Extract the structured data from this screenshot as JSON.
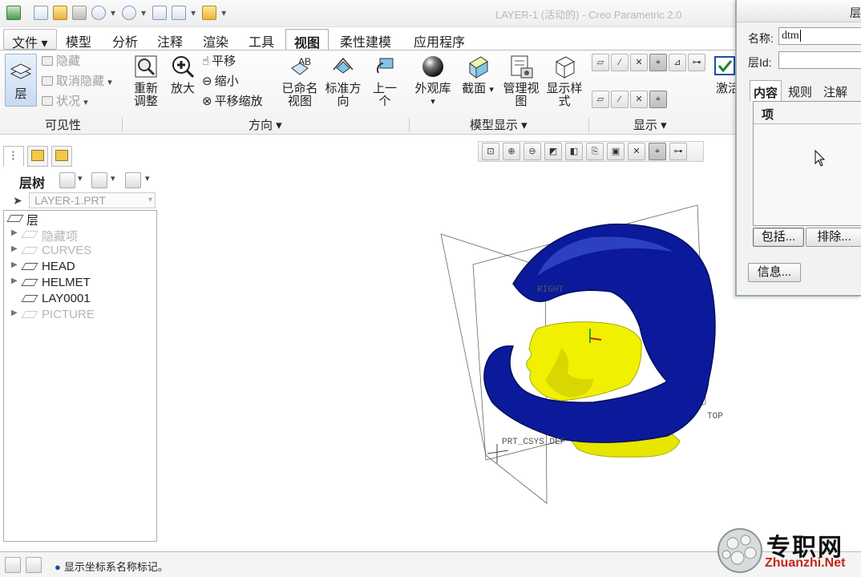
{
  "titlebar": {
    "title": "LAYER-1 (活动的) - Creo Parametric 2.0",
    "icons": [
      "creo-app-icon",
      "new-icon",
      "open-icon",
      "save-icon",
      "undo-icon",
      "redo-icon",
      "regenerate-icon",
      "windows-icon",
      "close-window-icon",
      "customize-icon"
    ]
  },
  "menu": {
    "tabs": [
      "文件",
      "模型",
      "分析",
      "注释",
      "渲染",
      "工具",
      "视图",
      "柔性建模",
      "应用程序"
    ],
    "active": "视图"
  },
  "ribbon": {
    "visibility": {
      "layer_label": "层",
      "hide_label": "隐藏",
      "unhide_label": "取消隐藏",
      "status_label": "状况",
      "group_label": "可见性"
    },
    "orientation": {
      "refit_label": "重新调整",
      "zoom_in_label": "放大",
      "pan_label": "平移",
      "zoom_out_label": "缩小",
      "pan_zoom_label": "平移缩放",
      "group_label": "方向"
    },
    "model_display": {
      "saved_views_label": "已命名视图",
      "standard_orient_label": "标准方向",
      "previous_label": "上一个",
      "appearance_label": "外观库",
      "section_label": "截面",
      "manage_views_label": "管理视图",
      "display_style_label": "显示样式",
      "group_label": "模型显示"
    },
    "show": {
      "group_label": "显示",
      "activate_label": "激活"
    }
  },
  "left_panel": {
    "tree_title": "层树",
    "model_name": "LAYER-1.PRT",
    "root_label": "层",
    "items": [
      {
        "label": "隐藏项",
        "expandable": true,
        "disabled": true
      },
      {
        "label": "CURVES",
        "expandable": true,
        "disabled": true
      },
      {
        "label": "HEAD",
        "expandable": true,
        "disabled": false
      },
      {
        "label": "HELMET",
        "expandable": true,
        "disabled": false
      },
      {
        "label": "LAY0001",
        "expandable": false,
        "disabled": false
      },
      {
        "label": "PICTURE",
        "expandable": true,
        "disabled": true
      }
    ]
  },
  "viewport": {
    "datum_labels": [
      "RIGHT",
      "TOP",
      "PRT_CSYS_DEF"
    ],
    "colors": {
      "helmet": "#0a1a9a",
      "head": "#f0f000",
      "background": "#ffffff"
    }
  },
  "dialog": {
    "title": "层",
    "name_label": "名称:",
    "name_value": "dtm",
    "id_label": "层Id:",
    "id_value": "",
    "tabs": [
      "内容",
      "规则",
      "注解"
    ],
    "active_tab": "内容",
    "list_header": "项",
    "include_button": "包括...",
    "exclude_button": "排除...",
    "info_button": "信息..."
  },
  "status": {
    "message": "显示坐标系名称标记。"
  },
  "watermark": {
    "logo_text": "专职网",
    "url": "Zhuanzhi.Net"
  }
}
